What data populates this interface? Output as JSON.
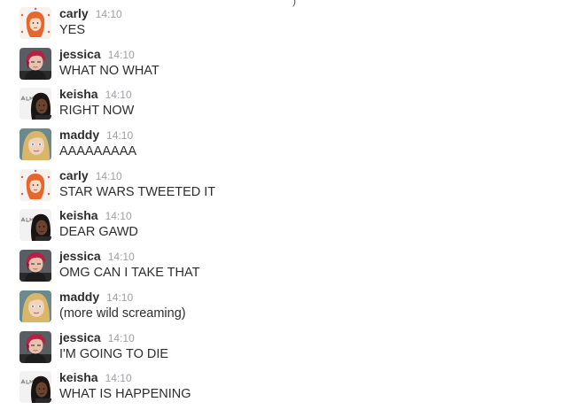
{
  "messages": [
    {
      "author": "carly",
      "time": "14:10",
      "text": "YES",
      "avatar": "carly-avatar"
    },
    {
      "author": "jessica",
      "time": "14:10",
      "text": "WHAT NO WHAT",
      "avatar": "jessica-avatar"
    },
    {
      "author": "keisha",
      "time": "14:10",
      "text": "RIGHT NOW",
      "avatar": "keisha-avatar"
    },
    {
      "author": "maddy",
      "time": "14:10",
      "text": "AAAAAAAAA",
      "avatar": "maddy-avatar"
    },
    {
      "author": "carly",
      "time": "14:10",
      "text": "STAR WARS TWEETED IT",
      "avatar": "carly-avatar"
    },
    {
      "author": "keisha",
      "time": "14:10",
      "text": "DEAR GAWD",
      "avatar": "keisha-avatar"
    },
    {
      "author": "jessica",
      "time": "14:10",
      "text": "OMG CAN I TAKE THAT",
      "avatar": "jessica-avatar"
    },
    {
      "author": "maddy",
      "time": "14:10",
      "text": "(more wild screaming)",
      "avatar": "maddy-avatar"
    },
    {
      "author": "jessica",
      "time": "14:10",
      "text": "I'M GOING TO DIE",
      "avatar": "jessica-avatar"
    },
    {
      "author": "keisha",
      "time": "14:10",
      "text": "WHAT IS HAPPENING",
      "avatar": "keisha-avatar"
    }
  ]
}
